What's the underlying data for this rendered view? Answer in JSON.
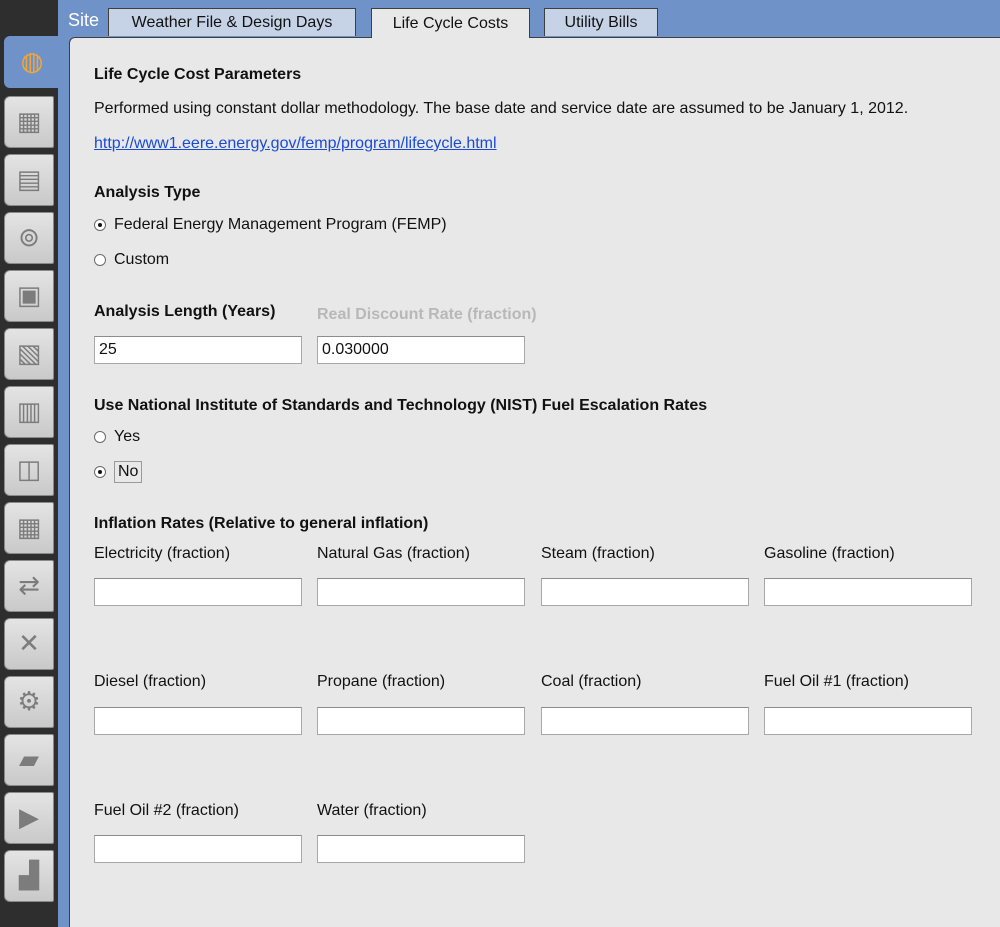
{
  "sidebar": {
    "icons": [
      {
        "icon": "globe-icon",
        "glyph": "◍"
      },
      {
        "icon": "calendar-icon",
        "glyph": "▦"
      },
      {
        "icon": "materials-icon",
        "glyph": "▤"
      },
      {
        "icon": "outlet-icon",
        "glyph": "⊚"
      },
      {
        "icon": "space-types-icon",
        "glyph": "▣"
      },
      {
        "icon": "geometry-icon",
        "glyph": "▧"
      },
      {
        "icon": "facility-icon",
        "glyph": "▥"
      },
      {
        "icon": "spaces-icon",
        "glyph": "◫"
      },
      {
        "icon": "thermal-zones-icon",
        "glyph": "▦"
      },
      {
        "icon": "hvac-loop-icon",
        "glyph": "⇄"
      },
      {
        "icon": "tools-icon",
        "glyph": "✕"
      },
      {
        "icon": "gear-icon",
        "glyph": "⚙"
      },
      {
        "icon": "scripts-icon",
        "glyph": "▰"
      },
      {
        "icon": "run-icon",
        "glyph": "▶"
      },
      {
        "icon": "results-chart-icon",
        "glyph": "▟"
      }
    ]
  },
  "header": {
    "site_label": "Site",
    "tabs": [
      {
        "label": "Weather File & Design Days"
      },
      {
        "label": "Life Cycle Costs"
      },
      {
        "label": "Utility Bills"
      }
    ]
  },
  "lcc": {
    "title": "Life Cycle Cost Parameters",
    "description": "Performed using constant dollar methodology.  The base date and service date are assumed to be January 1, 2012.",
    "link": "http://www1.eere.energy.gov/femp/program/lifecycle.html"
  },
  "analysis_type": {
    "heading": "Analysis Type",
    "option_femp": "Federal Energy Management Program (FEMP)",
    "option_custom": "Custom",
    "selected": "femp"
  },
  "analysis_length": {
    "label": "Analysis Length (Years)",
    "value": "25"
  },
  "discount_rate": {
    "label": "Real Discount Rate (fraction)",
    "value": "0.030000"
  },
  "nist": {
    "heading": "Use National Institute of Standards and Technology (NIST) Fuel Escalation Rates",
    "option_yes": "Yes",
    "option_no": "No",
    "selected": "no"
  },
  "inflation": {
    "heading": "Inflation Rates (Relative to general inflation)",
    "electricity": {
      "label": "Electricity (fraction)",
      "value": ""
    },
    "natural_gas": {
      "label": "Natural Gas (fraction)",
      "value": ""
    },
    "steam": {
      "label": "Steam (fraction)",
      "value": ""
    },
    "gasoline": {
      "label": "Gasoline (fraction)",
      "value": ""
    },
    "diesel": {
      "label": "Diesel (fraction)",
      "value": ""
    },
    "propane": {
      "label": "Propane (fraction)",
      "value": ""
    },
    "coal": {
      "label": "Coal (fraction)",
      "value": ""
    },
    "fuel_oil_1": {
      "label": "Fuel Oil #1 (fraction)",
      "value": ""
    },
    "fuel_oil_2": {
      "label": "Fuel Oil #2 (fraction)",
      "value": ""
    },
    "water": {
      "label": "Water (fraction)",
      "value": ""
    }
  },
  "colors": {
    "link": "#1a4bd6",
    "tab_bg": "#c6d3e6",
    "panel_bg": "#e8e8e8",
    "accent": "#6f93c8"
  }
}
